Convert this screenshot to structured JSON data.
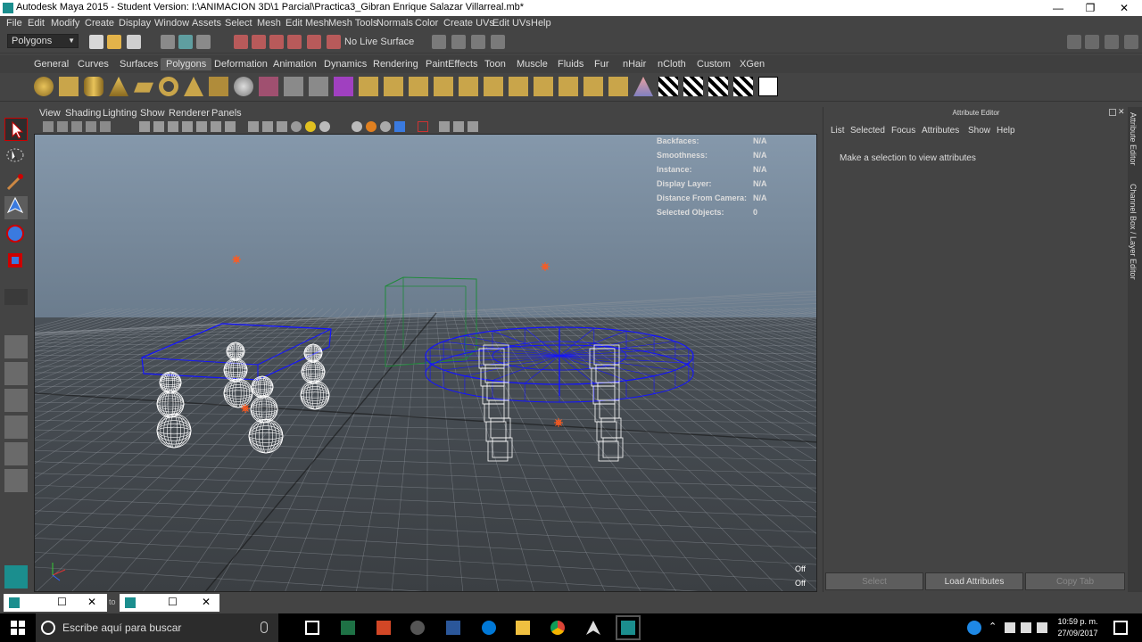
{
  "window": {
    "title": "Autodesk Maya 2015 - Student Version: I:\\ANIMACION 3D\\1 Parcial\\Practica3_Gibran Enrique Salazar Villarreal.mb*",
    "minimize": "—",
    "maximize": "❐",
    "close": "✕"
  },
  "menubar": [
    "File",
    "Edit",
    "Modify",
    "Create",
    "Display",
    "Window",
    "Assets",
    "Select",
    "Mesh",
    "Edit Mesh",
    "Mesh Tools",
    "Normals",
    "Color",
    "Create UVs",
    "Edit UVs",
    "Help"
  ],
  "statusline": {
    "mode": "Polygons",
    "live_surface": "No Live Surface"
  },
  "shelf_tabs": [
    "General",
    "Curves",
    "Surfaces",
    "Polygons",
    "Deformation",
    "Animation",
    "Dynamics",
    "Rendering",
    "PaintEffects",
    "Toon",
    "Muscle",
    "Fluids",
    "Fur",
    "nHair",
    "nCloth",
    "Custom",
    "XGen"
  ],
  "active_shelf_tab": "Polygons",
  "viewport_menu": [
    "View",
    "Shading",
    "Lighting",
    "Show",
    "Renderer",
    "Panels"
  ],
  "hud": [
    {
      "label": "Backfaces:",
      "value": "N/A"
    },
    {
      "label": "Smoothness:",
      "value": "N/A"
    },
    {
      "label": "Instance:",
      "value": "N/A"
    },
    {
      "label": "Display Layer:",
      "value": "N/A"
    },
    {
      "label": "Distance From Camera:",
      "value": "N/A"
    },
    {
      "label": "Selected Objects:",
      "value": "0"
    }
  ],
  "viewport_off": [
    "Off",
    "Off"
  ],
  "attribute_editor": {
    "title": "Attribute Editor",
    "menu": [
      "List",
      "Selected",
      "Focus",
      "Attributes",
      "Show",
      "Help"
    ],
    "message": "Make a selection to view attributes",
    "buttons": {
      "select": "Select",
      "load": "Load Attributes",
      "copy": "Copy Tab"
    }
  },
  "side_tabs": [
    "Attribute Editor",
    "Channel Box / Layer Editor"
  ],
  "taskbar": {
    "search_placeholder": "Escribe aquí para buscar",
    "time": "10:59 p. m.",
    "date": "27/09/2017"
  },
  "bottom": {
    "to_label": "to"
  },
  "colors": {
    "wire_blue": "#1414ff",
    "wire_white": "#ffffff",
    "wire_green": "#1f8a3a",
    "light_orange": "#ff5a1f"
  }
}
